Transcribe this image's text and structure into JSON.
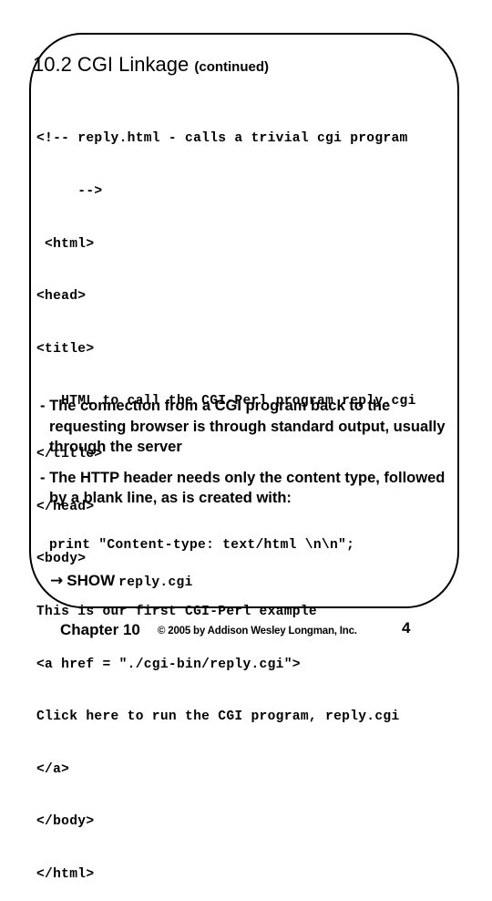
{
  "slide": {
    "title": "10.2 CGI Linkage",
    "title_suffix": "(continued)",
    "code_lines": [
      "<!-- reply.html - calls a trivial cgi program",
      "     -->",
      " <html>",
      "<head>",
      "<title>",
      "   HTML to call the CGI-Perl program reply.cgi",
      "</title>",
      "</head>",
      "<body>",
      "This is our first CGI-Perl example",
      "<a href = \"./cgi-bin/reply.cgi\">",
      "Click here to run the CGI program, reply.cgi",
      "</a>",
      "</body>",
      "</html>"
    ],
    "bullets": [
      "- The connection from a CGI program back to the requesting browser is through standard output, usually through the server",
      "- The HTTP header needs only the content type, followed by a blank line, as is created with:"
    ],
    "print_statement": "print \"Content-type: text/html \\n\\n\";",
    "show": {
      "arrow_icon": "→",
      "label": "SHOW",
      "file": "reply.cgi"
    }
  },
  "footer": {
    "chapter": "Chapter 10",
    "copyright": "© 2005 by Addison Wesley Longman, Inc.",
    "page_number": "4"
  }
}
